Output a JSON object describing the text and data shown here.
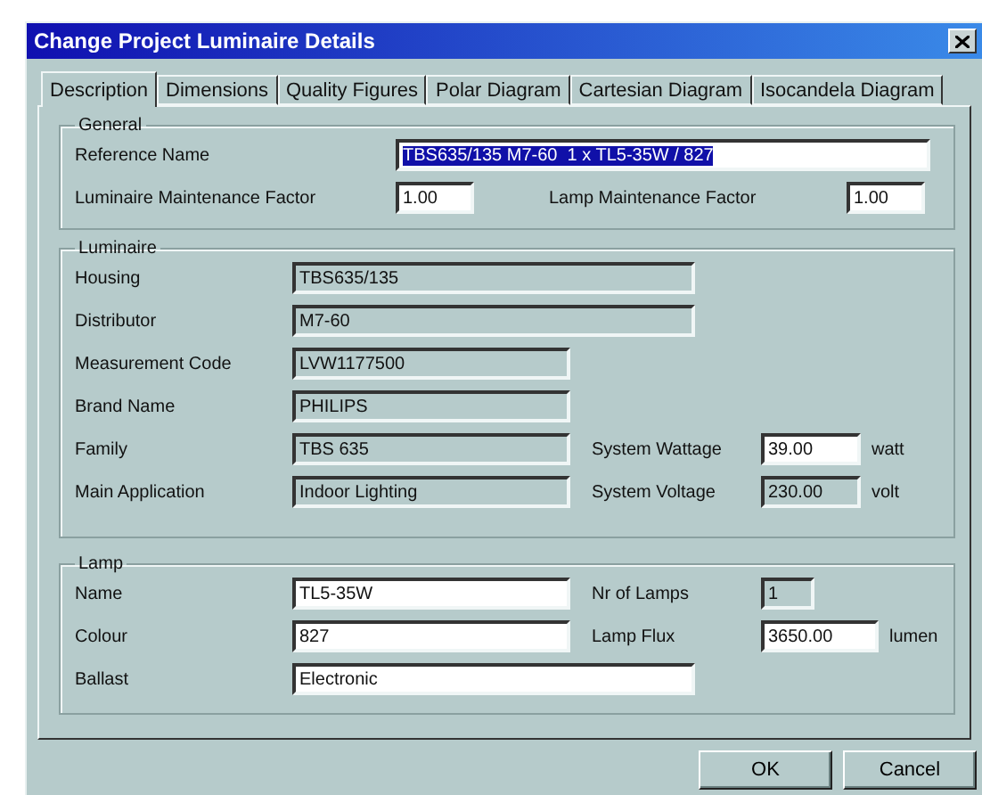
{
  "window": {
    "title": "Change Project Luminaire Details"
  },
  "tabs": [
    {
      "label": "Description",
      "selected": true
    },
    {
      "label": "Dimensions",
      "selected": false
    },
    {
      "label": "Quality Figures",
      "selected": false
    },
    {
      "label": "Polar Diagram",
      "selected": false
    },
    {
      "label": "Cartesian Diagram",
      "selected": false
    },
    {
      "label": "Isocandela Diagram",
      "selected": false
    }
  ],
  "general": {
    "title": "General",
    "reference": {
      "label": "Reference Name",
      "value": "TBS635/135 M7-60  1 x TL5-35W / 827",
      "selected": true
    },
    "factors": [
      {
        "label": "Luminaire Maintenance Factor",
        "value": "1.00"
      },
      {
        "label": "Lamp Maintenance Factor",
        "value": "1.00"
      }
    ]
  },
  "groups": [
    {
      "title": "Luminaire",
      "rows": [
        {
          "label": "Housing",
          "value": "TBS635/135",
          "readonly": true,
          "kind": "long"
        },
        {
          "label": "Distributor",
          "value": "M7-60",
          "readonly": true,
          "kind": "long"
        },
        {
          "label": "Measurement Code",
          "value": "LVW1177500",
          "readonly": true,
          "kind": "short"
        },
        {
          "label": "Brand Name",
          "value": "PHILIPS",
          "readonly": true,
          "kind": "short"
        },
        {
          "label": "Family",
          "value": "TBS 635",
          "readonly": true,
          "kind": "short",
          "extra": {
            "label": "System Wattage",
            "value": "39.00",
            "readonly": false,
            "kind": "medium",
            "unit": "watt"
          }
        },
        {
          "label": "Main Application",
          "value": "Indoor Lighting",
          "readonly": true,
          "kind": "short",
          "extra": {
            "label": "System Voltage",
            "value": "230.00",
            "readonly": true,
            "kind": "medium",
            "unit": "volt"
          }
        }
      ]
    },
    {
      "title": "Lamp",
      "rows": [
        {
          "label": "Name",
          "value": "TL5-35W",
          "readonly": false,
          "kind": "short",
          "extra": {
            "label": "Nr of Lamps",
            "value": "1",
            "readonly": true,
            "kind": "tiny"
          }
        },
        {
          "label": "Colour",
          "value": "827",
          "readonly": false,
          "kind": "short",
          "extra": {
            "label": "Lamp Flux",
            "value": "3650.00",
            "readonly": false,
            "kind": "wide",
            "unit": "lumen"
          }
        },
        {
          "label": "Ballast",
          "value": "Electronic",
          "readonly": false,
          "kind": "long"
        }
      ]
    }
  ],
  "buttons": [
    "OK",
    "Cancel"
  ]
}
